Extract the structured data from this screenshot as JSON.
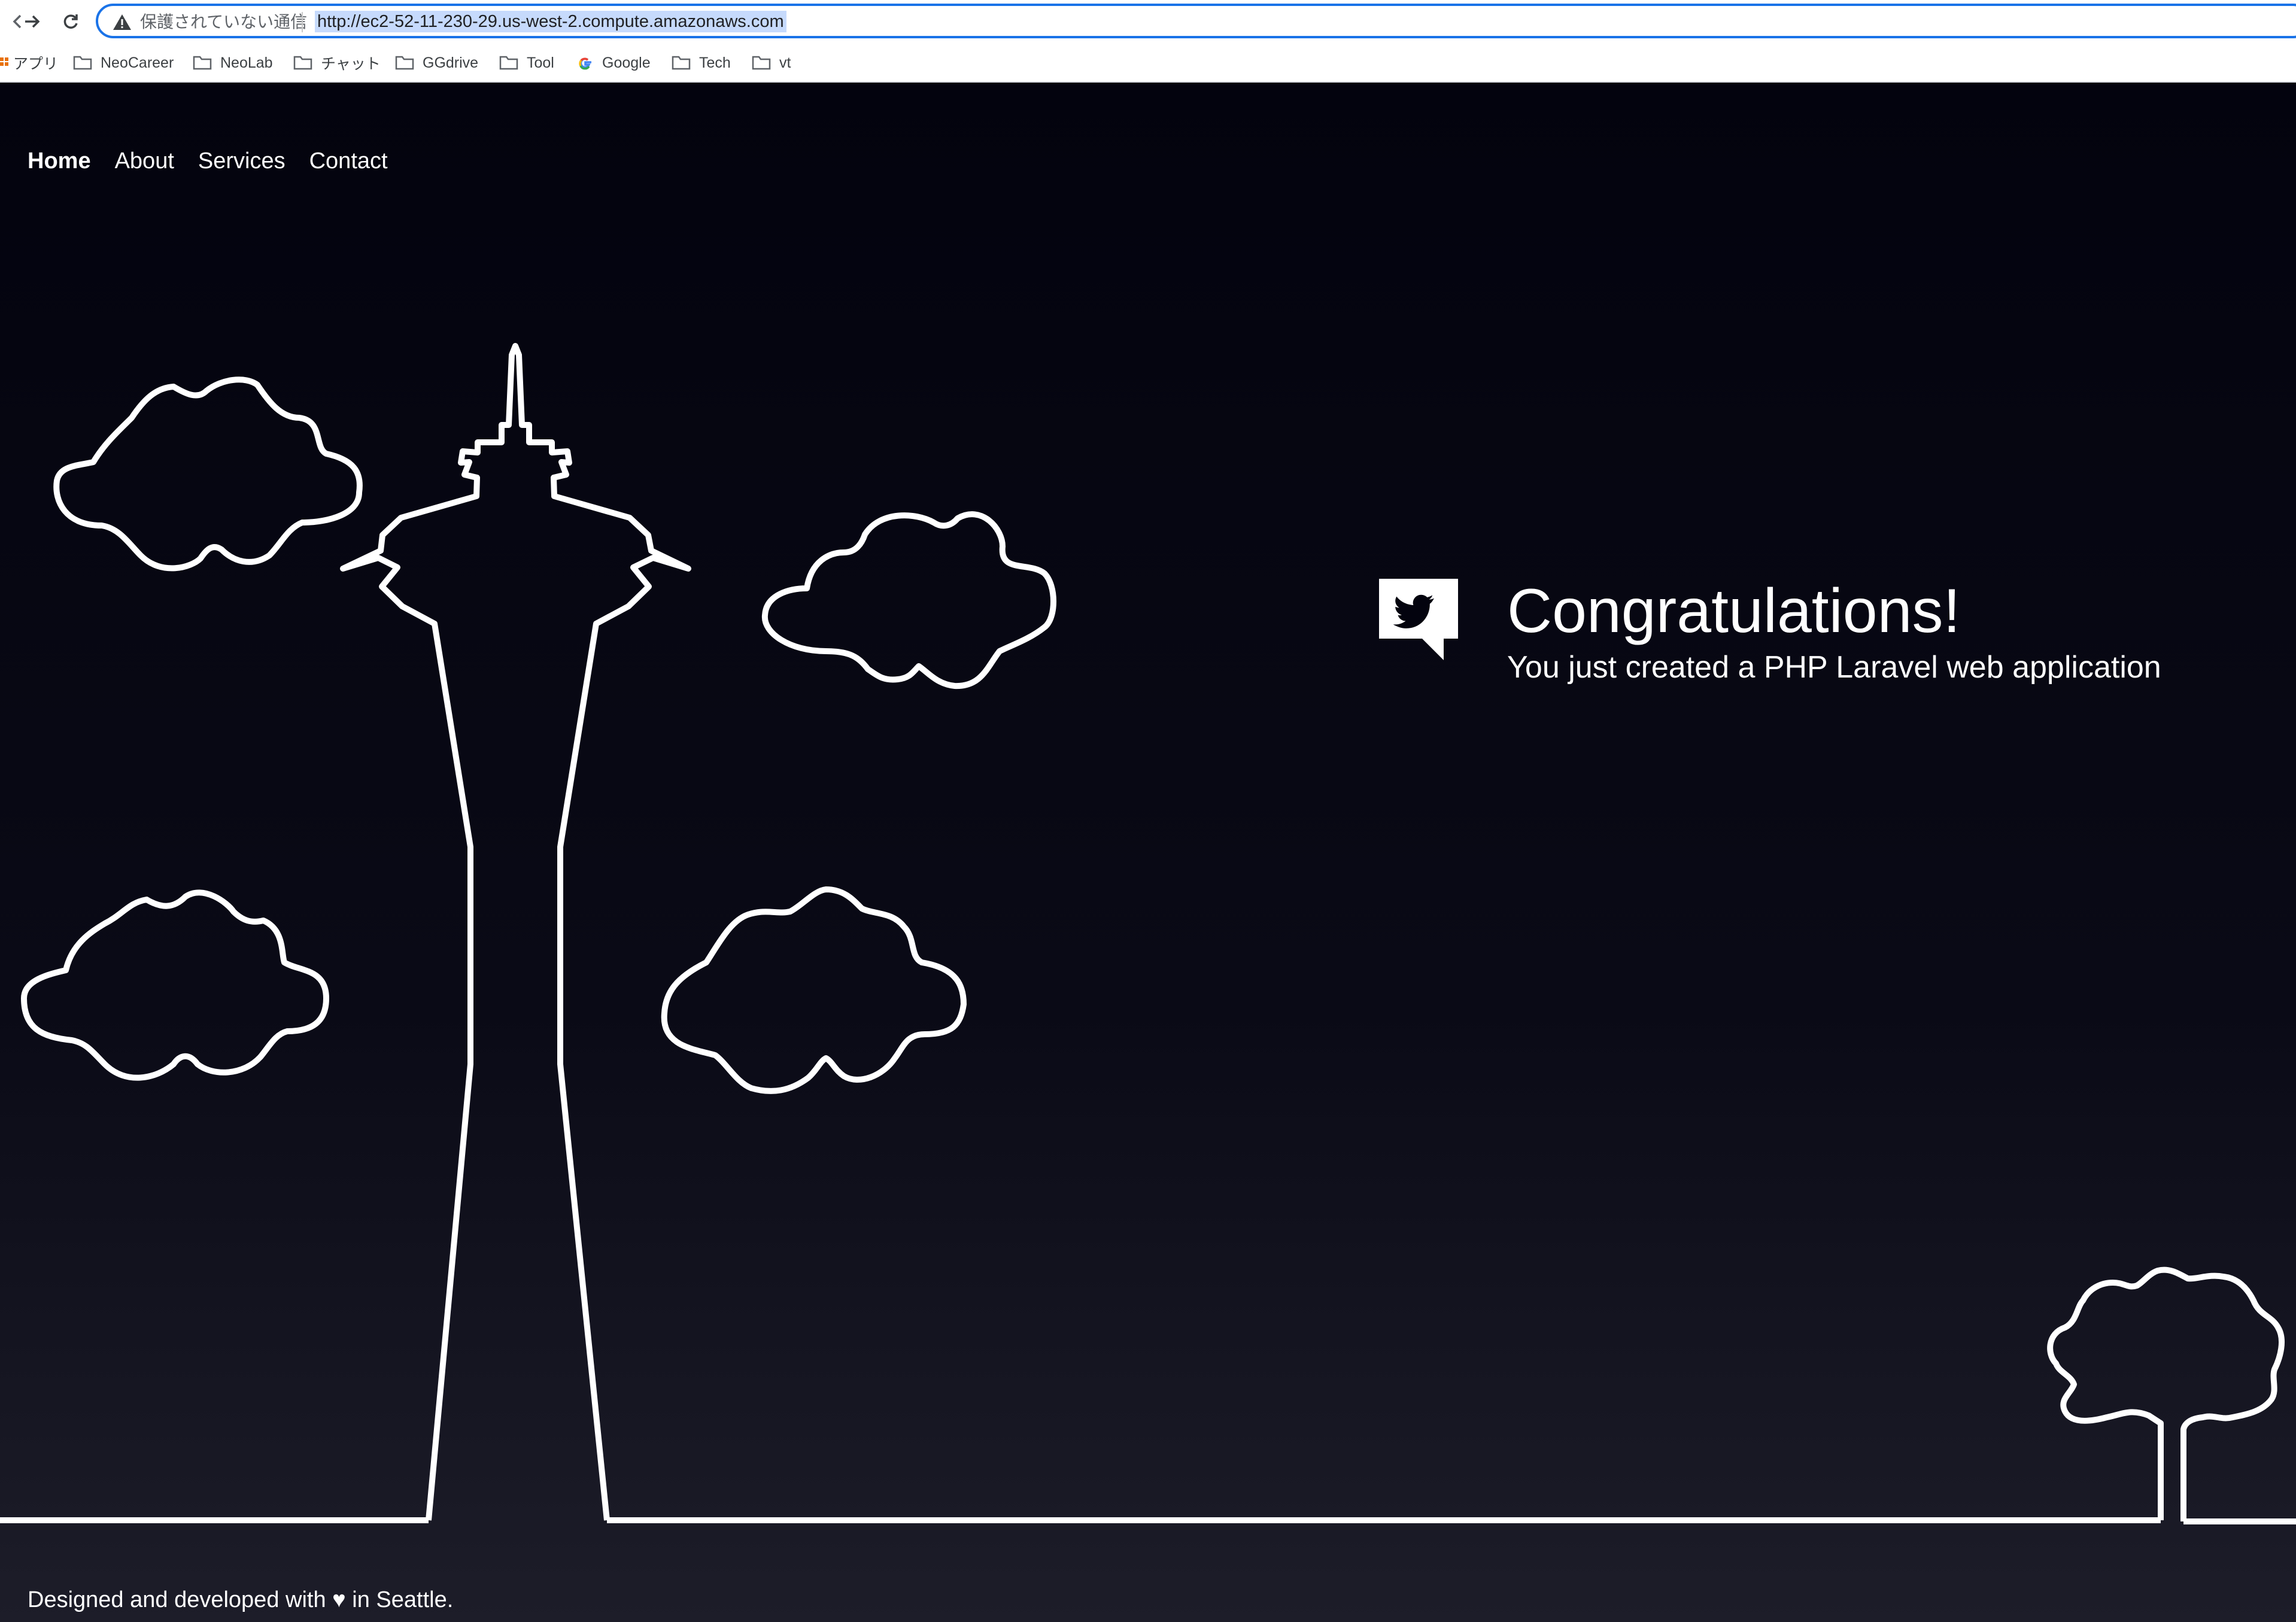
{
  "browser": {
    "security_label": "保護されていない通信",
    "url": "http://ec2-52-11-230-29.us-west-2.compute.amazonaws.com",
    "bookmarks": [
      {
        "label": "アプリ",
        "icon": "apps-grid-icon"
      },
      {
        "label": "NeoCareer",
        "icon": "folder-icon"
      },
      {
        "label": "NeoLab",
        "icon": "folder-icon"
      },
      {
        "label": "チャット",
        "icon": "folder-icon"
      },
      {
        "label": "GGdrive",
        "icon": "folder-icon"
      },
      {
        "label": "Tool",
        "icon": "folder-icon"
      },
      {
        "label": "Google",
        "icon": "google-icon"
      },
      {
        "label": "Tech",
        "icon": "folder-icon"
      },
      {
        "label": "vt",
        "icon": "folder-icon"
      }
    ]
  },
  "nav": {
    "home": "Home",
    "about": "About",
    "services": "Services",
    "contact": "Contact"
  },
  "hero": {
    "title": "Congratulations!",
    "subtitle": "You just created a PHP Laravel web application",
    "icon": "twitter-bubble-icon"
  },
  "footer": {
    "text": "Designed and developed with ♥ in Seattle."
  },
  "colors": {
    "background_top": "#03030e",
    "background_bottom": "#1d1d29",
    "line_art": "#ffffff",
    "omnibox_focus": "#1a73e8",
    "url_selection": "#c6dafc"
  }
}
